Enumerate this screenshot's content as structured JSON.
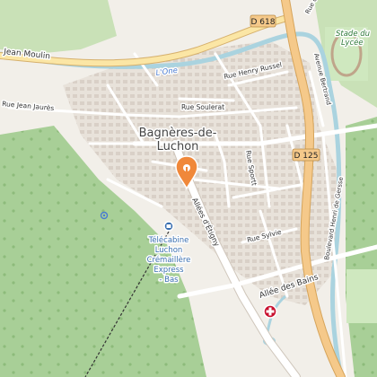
{
  "labels": {
    "town_line1": "Bagnères-de-",
    "town_line2": "Luchon",
    "road_d618": "D 618",
    "road_d125": "D 125",
    "jean_moulin": "Jean Moulin",
    "l_one": "L'One",
    "rue_henry_russel": "Rue Henry Russel",
    "rue_jean_jaures": "Rue Jean Jaurès",
    "rue_soulerat": "Rue Soulerat",
    "rue_sportt": "Rue Sportt",
    "rue_sylvie": "Rue Sylvie",
    "allees_etigny": "Allées d'Étigny",
    "allee_des_bains": "Allée des Bains",
    "avenue_bertrand": "Avenue Bertrand",
    "rue_de_la": "Rue de la",
    "boulevard_gerssel": "Boulevard Henri de Gersse",
    "stade_line1": "Stade du",
    "stade_line2": "Lycée",
    "poi_line1": "Télécabine",
    "poi_line2": "Luchon",
    "poi_line3": "Crémaillère",
    "poi_line4": "Express",
    "poi_line5": "- Bas"
  },
  "colors": {
    "forest": "#a8cf97",
    "background": "#f2efe9",
    "primary_road": "#f5c98a",
    "river": "#aad3df",
    "pin": "#f0883a",
    "pharmacy": "#c8102e"
  },
  "icons": [
    "location-pin-icon",
    "cable-car-station-icon",
    "pharmacy-cross-icon",
    "viewpoint-icon"
  ]
}
